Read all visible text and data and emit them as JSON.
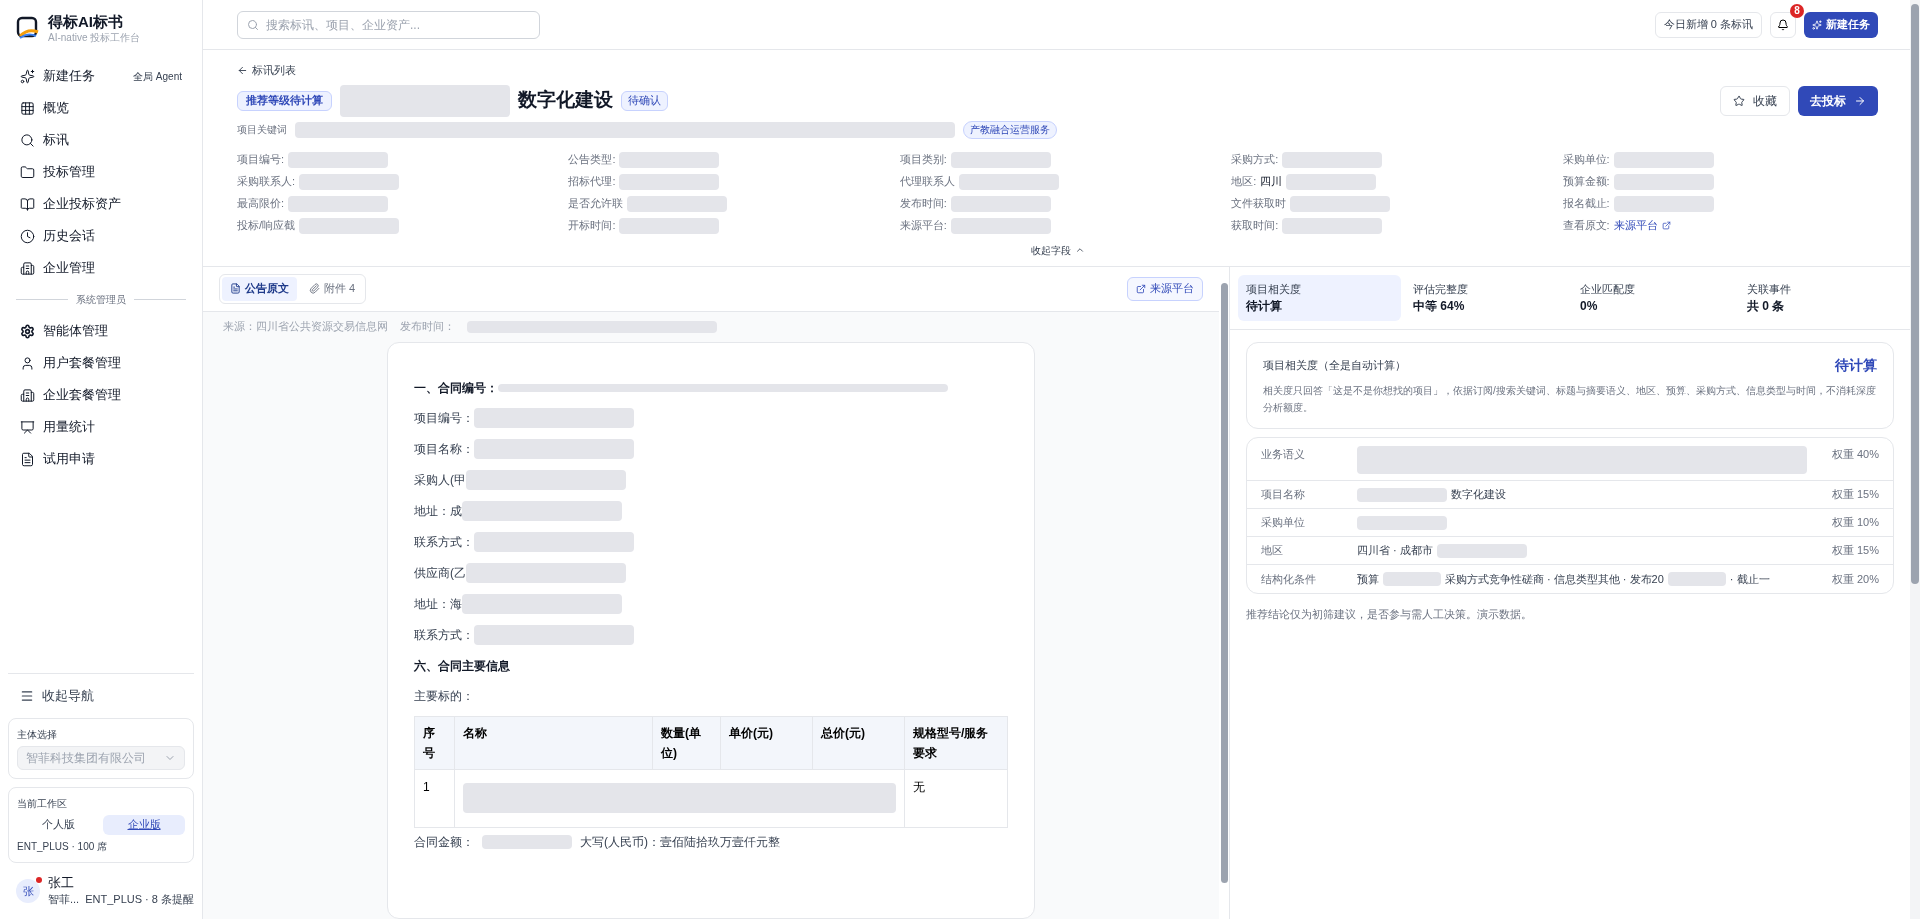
{
  "brand": {
    "title": "得标AI标书",
    "subtitle": "AI-native 投标工作台"
  },
  "nav": [
    {
      "label": "新建任务",
      "badge": "全局 Agent"
    },
    {
      "label": "概览"
    },
    {
      "label": "标讯"
    },
    {
      "label": "投标管理"
    },
    {
      "label": "企业投标资产"
    },
    {
      "label": "历史会话"
    },
    {
      "label": "企业管理"
    }
  ],
  "admin_section": {
    "title": "系统管理员",
    "items": [
      {
        "label": "智能体管理"
      },
      {
        "label": "用户套餐管理"
      },
      {
        "label": "企业套餐管理"
      },
      {
        "label": "用量统计"
      },
      {
        "label": "试用申请"
      }
    ]
  },
  "collapse_nav": "收起导航",
  "entity_select": {
    "label": "主体选择",
    "value": "智菲科技集团有限公司",
    "disabled": true
  },
  "workspace": {
    "label": "当前工作区",
    "options": [
      {
        "label": "个人版",
        "selected": false
      },
      {
        "label": "企业版",
        "selected": true
      }
    ],
    "plan": "ENT_PLUS · 100 席"
  },
  "user": {
    "avatar": "张",
    "name": "张工",
    "org": "智菲...",
    "info": "ENT_PLUS · 8 条提醒",
    "online": true
  },
  "topbar": {
    "search_placeholder": "搜索标讯、项目、企业资产...",
    "today": "今日新增 0 条标讯",
    "notifications": "8",
    "new_task": "新建任务"
  },
  "detail": {
    "back": "标讯列表",
    "grade_badge": "推荐等级待计算",
    "title": "数字化建设",
    "status": "待确认",
    "favorite": "收藏",
    "go_bid": "去投标",
    "keywords_label": "项目关键词",
    "keywords": [
      {
        "kind": "redacted"
      },
      {
        "kind": "tag",
        "text": "产教融合运营服务"
      }
    ],
    "fields": [
      {
        "label": "项目编号:"
      },
      {
        "label": "公告类型:"
      },
      {
        "label": "项目类别:"
      },
      {
        "label": "采购方式:"
      },
      {
        "label": "采购单位:"
      },
      {
        "label": "采购联系人:"
      },
      {
        "label": "招标代理:"
      },
      {
        "label": "代理联系人"
      },
      {
        "label": "地区:",
        "value": "四川"
      },
      {
        "label": "预算金额:"
      },
      {
        "label": "最高限价:"
      },
      {
        "label": "是否允许联"
      },
      {
        "label": "发布时间:"
      },
      {
        "label": "文件获取时"
      },
      {
        "label": "报名截止:"
      },
      {
        "label": "投标/响应截"
      },
      {
        "label": "开标时间:"
      },
      {
        "label": "来源平台:"
      },
      {
        "label": "获取时间:"
      },
      {
        "label": "查看原文:",
        "link": "来源平台"
      }
    ],
    "collapse_fields": "收起字段"
  },
  "doc_tabs": [
    {
      "label": "公告原文",
      "selected": true
    },
    {
      "label": "附件 4",
      "selected": false
    }
  ],
  "source_button": "来源平台",
  "source_line": {
    "source": "来源：四川省公共资源交易信息网",
    "time_label": "发布时间："
  },
  "document": [
    {
      "kind": "heading",
      "text": "一、合同编号："
    },
    {
      "kind": "line",
      "text": "项目编号："
    },
    {
      "kind": "line",
      "text": "项目名称："
    },
    {
      "kind": "line",
      "text": "采购人(甲"
    },
    {
      "kind": "line",
      "text": "地址：成"
    },
    {
      "kind": "line",
      "text": "联系方式："
    },
    {
      "kind": "line",
      "text": "供应商(乙"
    },
    {
      "kind": "line",
      "text": "地址：海"
    },
    {
      "kind": "line",
      "text": "联系方式："
    },
    {
      "kind": "heading",
      "text": "六、合同主要信息"
    },
    {
      "kind": "plain",
      "text": "主要标的："
    }
  ],
  "items_table": {
    "columns": [
      "序号",
      "名称",
      "数量(单位)",
      "单价(元)",
      "总价(元)",
      "规格型号/服务要求"
    ],
    "rows": [
      {
        "index": "1",
        "spec": "无"
      }
    ]
  },
  "contract_amount": {
    "label": "合同金额：",
    "upper": "大写(人民币)：壹佰陆拾玖万壹仟元整"
  },
  "metrics": [
    {
      "label": "项目相关度",
      "value": "待计算",
      "selected": true
    },
    {
      "label": "评估完整度",
      "value": "中等 64%",
      "selected": false
    },
    {
      "label": "企业匹配度",
      "value": "0%",
      "selected": false
    },
    {
      "label": "关联事件",
      "value": "共 0 条",
      "selected": false
    }
  ],
  "relevance": {
    "title": "项目相关度（全是自动计算）",
    "status": "待计算",
    "description": "相关度只回答「这是不是你想找的项目」，依据订阅/搜索关键词、标题与摘要语义、地区、预算、采购方式、信息类型与时间，不消耗深度分析额度。",
    "rows": [
      {
        "label": "业务语义",
        "parts": [
          {
            "kind": "redacted"
          }
        ],
        "weight": "权重 40%"
      },
      {
        "label": "项目名称",
        "parts": [
          {
            "kind": "redacted"
          },
          {
            "kind": "text",
            "text": "数字化建设"
          }
        ],
        "weight": "权重 15%"
      },
      {
        "label": "采购单位",
        "parts": [
          {
            "kind": "redacted"
          }
        ],
        "weight": "权重 10%"
      },
      {
        "label": "地区",
        "parts": [
          {
            "kind": "text",
            "text": "四川省 · 成都市"
          },
          {
            "kind": "redacted"
          }
        ],
        "weight": "权重 15%"
      },
      {
        "label": "结构化条件",
        "parts": [
          {
            "kind": "text",
            "text": "预算"
          },
          {
            "kind": "redacted"
          },
          {
            "kind": "text",
            "text": "采购方式竞争性磋商 · 信息类型其他 · 发布20"
          },
          {
            "kind": "redacted"
          },
          {
            "kind": "text",
            "text": "· 截止一"
          }
        ],
        "weight": "权重 20%"
      }
    ]
  },
  "footnote": "推荐结论仅为初筛建议，是否参与需人工决策。演示数据。"
}
